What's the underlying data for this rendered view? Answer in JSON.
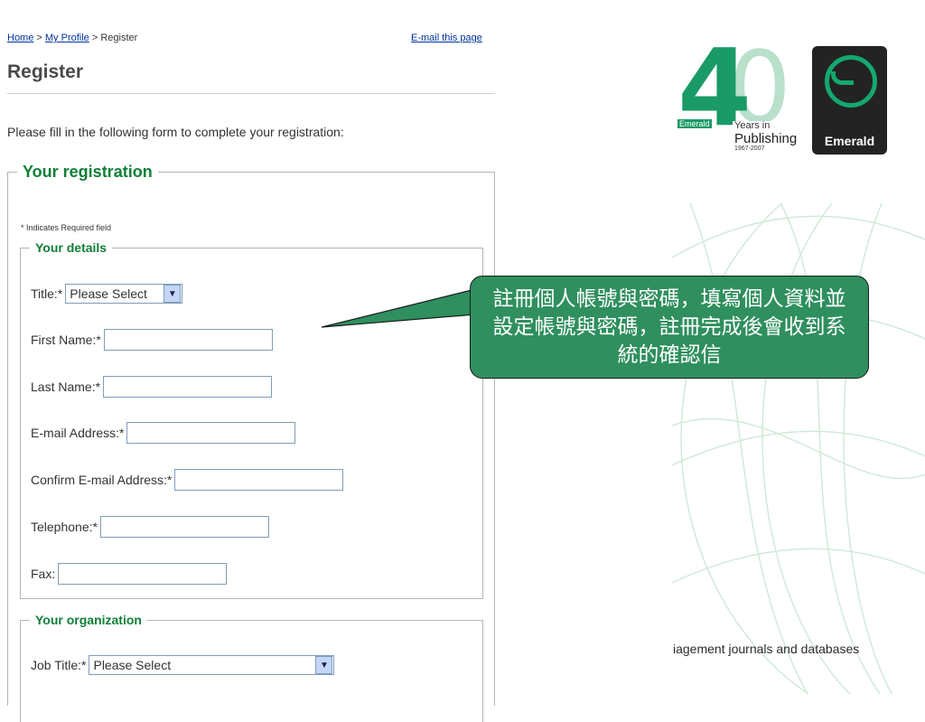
{
  "breadcrumb": {
    "home": "Home",
    "sep1": " > ",
    "profile": "My Profile",
    "sep2": " > ",
    "current": "Register"
  },
  "email_link": "E-mail this page",
  "page_title": "Register",
  "intro": "Please fill in the following form to complete your registration:",
  "registration": {
    "legend": "Your registration",
    "required_note": "* Indicates Required field",
    "details": {
      "legend": "Your details",
      "title_label": "Title:*",
      "title_value": "Please Select",
      "first_name_label": "First Name:*",
      "last_name_label": "Last Name:*",
      "email_label": "E-mail Address:*",
      "confirm_email_label": "Confirm E-mail Address:*",
      "telephone_label": "Telephone:*",
      "fax_label": "Fax:"
    },
    "organization": {
      "legend": "Your organization",
      "job_title_label": "Job Title:*",
      "job_title_value": "Please Select"
    }
  },
  "logo": {
    "number_four": "4",
    "number_zero": "0",
    "brand_small": "Emerald",
    "years_in": "Years in",
    "publishing": "Publishing",
    "range": "1967-2007"
  },
  "badge_name": "Emerald",
  "tagline": "iagement journals and databases",
  "callout": "註冊個人帳號與密碼，填寫個人資料並設定帳號與密碼，註冊完成後會收到系統的確認信",
  "colors": {
    "accent_green": "#0f7f37",
    "callout_bg": "#2f8f5e",
    "link": "#003399"
  }
}
